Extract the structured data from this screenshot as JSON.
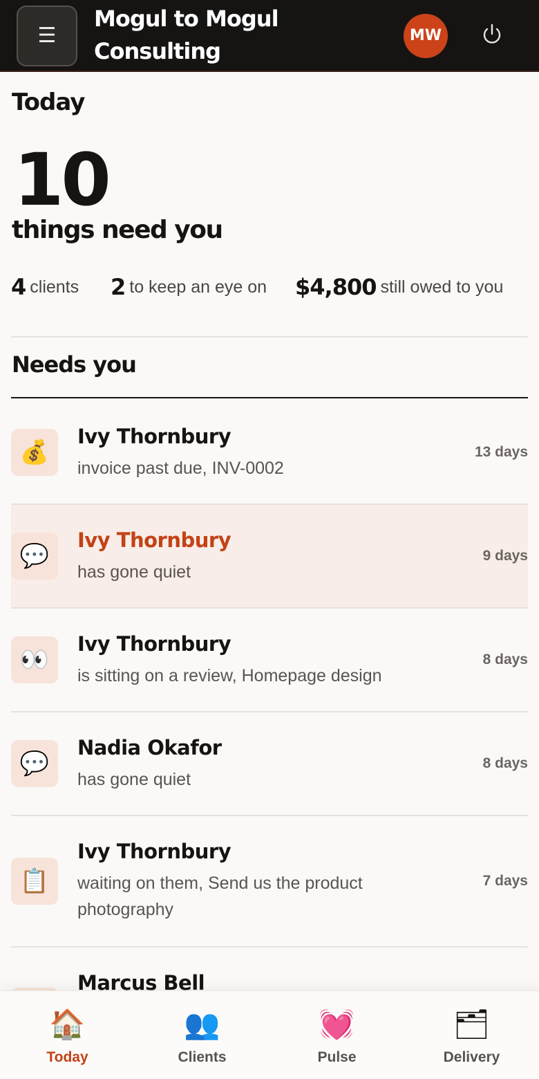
{
  "header": {
    "menu_icon": "☰",
    "brand": "Mogul to Mogul Consulting",
    "avatar_initials": "MW",
    "accent": "#cc4319"
  },
  "summary": {
    "title": "Today",
    "count": "10",
    "count_label": "things need you",
    "stats": [
      {
        "value": "4",
        "label": "clients"
      },
      {
        "value": "2",
        "label": "to keep an eye on"
      },
      {
        "value": "$4,800",
        "label": "still owed to you"
      }
    ]
  },
  "needs_you": {
    "title": "Needs you",
    "items": [
      {
        "icon": "💰",
        "icon_name": "money-bag-icon",
        "name": "Ivy Thornbury",
        "desc": "invoice past due, INV-0002",
        "days": "13 days"
      },
      {
        "icon": "💬",
        "icon_name": "speech-bubble-icon",
        "name": "Ivy Thornbury",
        "desc": "has gone quiet",
        "days": "9 days",
        "highlight": true
      },
      {
        "icon": "👀",
        "icon_name": "eyes-icon",
        "name": "Ivy Thornbury",
        "desc": "is sitting on a review, Homepage design",
        "days": "8 days"
      },
      {
        "icon": "💬",
        "icon_name": "speech-bubble-icon",
        "name": "Nadia Okafor",
        "desc": "has gone quiet",
        "days": "8 days"
      },
      {
        "icon": "📋",
        "icon_name": "clipboard-icon",
        "name": "Ivy Thornbury",
        "desc": "waiting on them, Send us the product photography",
        "days": "7 days"
      },
      {
        "icon": "",
        "icon_name": "item-icon",
        "name": "Marcus Bell",
        "desc": "",
        "days": ""
      }
    ]
  },
  "nav": [
    {
      "icon": "🏠",
      "icon_name": "home-icon",
      "label": "Today",
      "active": true
    },
    {
      "icon": "👥",
      "icon_name": "clients-icon",
      "label": "Clients"
    },
    {
      "icon": "💓",
      "icon_name": "heart-icon",
      "label": "Pulse"
    },
    {
      "icon": "🗂",
      "icon_name": "folder-icon",
      "label": "Delivery"
    }
  ]
}
